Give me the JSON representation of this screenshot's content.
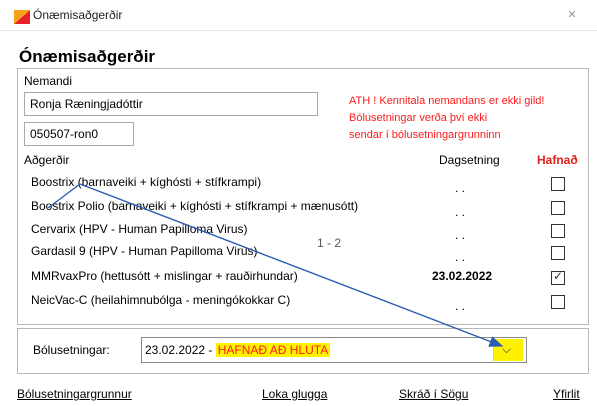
{
  "window": {
    "title": "Ónæmisaðgerðir",
    "close_icon": "close-icon",
    "app_icon": "app-icon"
  },
  "dialog": {
    "heading": "Ónæmisaðgerðir"
  },
  "student": {
    "label": "Nemandi",
    "name_value": "Ronja Ræningjadóttir",
    "id_value": "050507-ron0",
    "warning_lines": [
      "ATH ! Kennitala nemandans er ekki gild!",
      "Bólusetningar verða því ekki",
      "sendar í bólusetningargrunninn"
    ]
  },
  "actions": {
    "col_procedure": "Aðgerðir",
    "col_date": "Dagsetning",
    "col_declined": "Hafnað",
    "rows": [
      {
        "name": "Boostrix (barnaveiki + kíghósti + stífkrampi)",
        "date": ". .",
        "declined": false
      },
      {
        "name": "Boostrix Polio (barnaveiki + kíghósti + stífkrampi + mænusótt)",
        "date": ". .",
        "declined": false
      },
      {
        "name": "Cervarix (HPV - Human Papilloma Virus)",
        "date": ". .",
        "declined": false
      },
      {
        "name": "Gardasil 9 (HPV - Human Papilloma Virus)",
        "date": ". .",
        "declined": false
      },
      {
        "name": "MMRvaxPro (hettusótt + mislingar + rauðirhundar)",
        "date": "23.02.2022",
        "declined": true
      },
      {
        "name": "NeicVac-C (heilahimnubólga - meningókokkar C)",
        "date": ". .",
        "declined": false
      }
    ],
    "pager": "1 - 2"
  },
  "vaccinations": {
    "label": "Bólusetningar:",
    "selected_date": "23.02.2022 - ",
    "selected_status": "HAFNAÐ AÐ HLUTA"
  },
  "footer": {
    "links": [
      "Bólusetningargrunnur",
      "Loka glugga",
      "Skráð í Sögu",
      "Yfirlit"
    ]
  },
  "colors": {
    "warning": "#ff1a1a",
    "highlight": "#fff200",
    "annotation_arrow": "#2a5db0"
  }
}
